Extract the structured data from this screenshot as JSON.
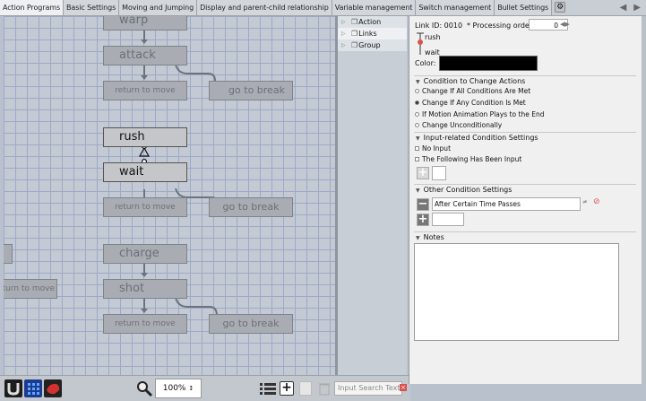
{
  "tabs": [
    {
      "label": "Action Programs",
      "active": true
    },
    {
      "label": "Basic Settings"
    },
    {
      "label": "Moving and Jumping"
    },
    {
      "label": "Display and parent-child relationship"
    },
    {
      "label": "Variable management"
    },
    {
      "label": "Switch management"
    },
    {
      "label": "Bullet Settings"
    }
  ],
  "canvas": {
    "nodes": {
      "warp": "warp",
      "attack": "attack",
      "return_to_move_1": "return to move",
      "go_to_break_1": "go to break",
      "rush": "rush",
      "wait": "wait",
      "return_to_move_2": "return to move",
      "go_to_break_2": "go to break",
      "left_stub": "",
      "charge": "charge",
      "left_return": "turn to move",
      "shot": "shot",
      "return_to_move_3": "return to move",
      "go_to_break_3": "go to break"
    }
  },
  "toolbar": {
    "zoom": "100%",
    "search_placeholder": "Input Search Text"
  },
  "tree": {
    "items": [
      {
        "label": "Action"
      },
      {
        "label": "Links",
        "selected": true
      },
      {
        "label": "Group"
      }
    ]
  },
  "props": {
    "link_id": "Link ID: 0010",
    "processing_order_label": "* Processing order:",
    "processing_order_value": "0",
    "from_action": "rush",
    "to_action": "wait",
    "color_label": "Color:",
    "color_value": "#000000",
    "condition_section": "Condition to Change Actions",
    "condition_options": [
      {
        "label": "Change If All Conditions Are Met",
        "selected": false
      },
      {
        "label": "Change If Any Condition Is Met",
        "selected": true
      },
      {
        "label": "If Motion Animation Plays to the End",
        "selected": false
      },
      {
        "label": "Change Unconditionally",
        "selected": false
      }
    ],
    "input_section": "Input-related Condition Settings",
    "input_options": [
      {
        "label": "No Input"
      },
      {
        "label": "The Following Has Been Input"
      }
    ],
    "other_section": "Other Condition Settings",
    "other_condition": "After Certain Time Passes",
    "notes_section": "Notes"
  }
}
